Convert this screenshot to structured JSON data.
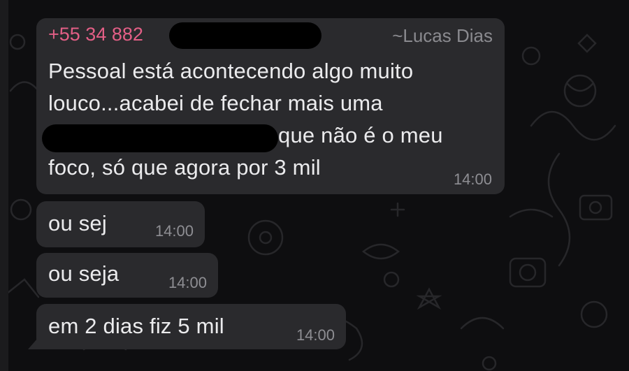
{
  "messages": [
    {
      "sender_phone": "+55 34 882",
      "sender_name": "~Lucas Dias",
      "lines": [
        "Pessoal está acontecendo algo muito",
        "louco...acabei de fechar mais uma",
        "que não é o meu",
        "foco, só que agora por 3 mil"
      ],
      "time": "14:00"
    },
    {
      "text": "ou sej",
      "time": "14:00"
    },
    {
      "text": "ou seja",
      "time": "14:00"
    },
    {
      "text": "em 2 dias fiz 5 mil",
      "time": "14:00"
    }
  ],
  "colors": {
    "background": "#0e0e10",
    "bubble": "#2a2a2d",
    "sender_phone": "#e35f86",
    "timestamp": "#8e8e93"
  }
}
